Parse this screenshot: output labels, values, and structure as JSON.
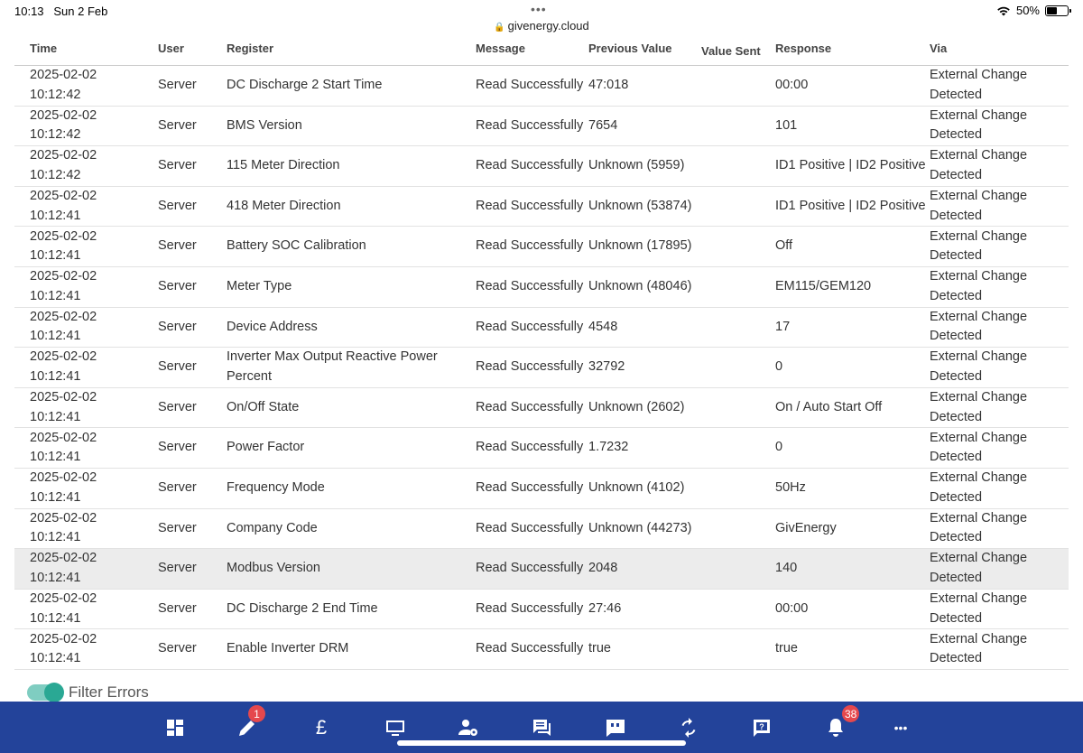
{
  "status_bar": {
    "time": "10:13",
    "date": "Sun 2 Feb",
    "battery": "50%",
    "url": "givenergy.cloud"
  },
  "table": {
    "headers": {
      "time": "Time",
      "user": "User",
      "register": "Register",
      "message": "Message",
      "previous_value": "Previous Value",
      "value_sent": "Value Sent",
      "response": "Response",
      "via": "Via"
    },
    "rows": [
      {
        "date": "2025-02-02",
        "time": "10:12:42",
        "user": "Server",
        "register": "DC Discharge 2 Start Time",
        "message": "Read Successfully",
        "previous": "47:018",
        "sent": "",
        "response": "00:00",
        "via": "External Change Detected"
      },
      {
        "date": "2025-02-02",
        "time": "10:12:42",
        "user": "Server",
        "register": "BMS Version",
        "message": "Read Successfully",
        "previous": "7654",
        "sent": "",
        "response": "101",
        "via": "External Change Detected"
      },
      {
        "date": "2025-02-02",
        "time": "10:12:42",
        "user": "Server",
        "register": "115 Meter Direction",
        "message": "Read Successfully",
        "previous": "Unknown (5959)",
        "sent": "",
        "response": "ID1 Positive | ID2 Positive",
        "via": "External Change Detected"
      },
      {
        "date": "2025-02-02",
        "time": "10:12:41",
        "user": "Server",
        "register": "418 Meter Direction",
        "message": "Read Successfully",
        "previous": "Unknown (53874)",
        "sent": "",
        "response": "ID1 Positive | ID2 Positive",
        "via": "External Change Detected"
      },
      {
        "date": "2025-02-02",
        "time": "10:12:41",
        "user": "Server",
        "register": "Battery SOC Calibration",
        "message": "Read Successfully",
        "previous": "Unknown (17895)",
        "sent": "",
        "response": "Off",
        "via": "External Change Detected"
      },
      {
        "date": "2025-02-02",
        "time": "10:12:41",
        "user": "Server",
        "register": "Meter Type",
        "message": "Read Successfully",
        "previous": "Unknown (48046)",
        "sent": "",
        "response": "EM115/GEM120",
        "via": "External Change Detected"
      },
      {
        "date": "2025-02-02",
        "time": "10:12:41",
        "user": "Server",
        "register": "Device Address",
        "message": "Read Successfully",
        "previous": "4548",
        "sent": "",
        "response": "17",
        "via": "External Change Detected"
      },
      {
        "date": "2025-02-02",
        "time": "10:12:41",
        "user": "Server",
        "register": "Inverter Max Output Reactive Power Percent",
        "message": "Read Successfully",
        "previous": "32792",
        "sent": "",
        "response": "0",
        "via": "External Change Detected"
      },
      {
        "date": "2025-02-02",
        "time": "10:12:41",
        "user": "Server",
        "register": "On/Off State",
        "message": "Read Successfully",
        "previous": "Unknown (2602)",
        "sent": "",
        "response": "On / Auto Start Off",
        "via": "External Change Detected"
      },
      {
        "date": "2025-02-02",
        "time": "10:12:41",
        "user": "Server",
        "register": "Power Factor",
        "message": "Read Successfully",
        "previous": "1.7232",
        "sent": "",
        "response": "0",
        "via": "External Change Detected"
      },
      {
        "date": "2025-02-02",
        "time": "10:12:41",
        "user": "Server",
        "register": "Frequency Mode",
        "message": "Read Successfully",
        "previous": "Unknown (4102)",
        "sent": "",
        "response": "50Hz",
        "via": "External Change Detected"
      },
      {
        "date": "2025-02-02",
        "time": "10:12:41",
        "user": "Server",
        "register": "Company Code",
        "message": "Read Successfully",
        "previous": "Unknown (44273)",
        "sent": "",
        "response": "GivEnergy",
        "via": "External Change Detected"
      },
      {
        "date": "2025-02-02",
        "time": "10:12:41",
        "user": "Server",
        "register": "Modbus Version",
        "message": "Read Successfully",
        "previous": "2048",
        "sent": "",
        "response": "140",
        "via": "External Change Detected",
        "highlight": true
      },
      {
        "date": "2025-02-02",
        "time": "10:12:41",
        "user": "Server",
        "register": "DC Discharge 2 End Time",
        "message": "Read Successfully",
        "previous": "27:46",
        "sent": "",
        "response": "00:00",
        "via": "External Change Detected"
      },
      {
        "date": "2025-02-02",
        "time": "10:12:41",
        "user": "Server",
        "register": "Enable Inverter DRM",
        "message": "Read Successfully",
        "previous": "true",
        "sent": "",
        "response": "true",
        "via": "External Change Detected"
      }
    ]
  },
  "filter": {
    "label": "Filter Errors",
    "enabled": true,
    "color": "#2aa894"
  },
  "nav": {
    "background": "#23439a",
    "items": [
      {
        "icon": "dashboard-icon"
      },
      {
        "icon": "pencil-icon",
        "badge": "1"
      },
      {
        "icon": "pound-icon",
        "glyph": "£"
      },
      {
        "icon": "monitor-icon"
      },
      {
        "icon": "user-settings-icon"
      },
      {
        "icon": "messages-icon"
      },
      {
        "icon": "feedback-icon"
      },
      {
        "icon": "sync-icon"
      },
      {
        "icon": "help-icon"
      },
      {
        "icon": "bell-icon",
        "badge": "38"
      },
      {
        "icon": "more-icon",
        "glyph": "•••"
      }
    ]
  }
}
